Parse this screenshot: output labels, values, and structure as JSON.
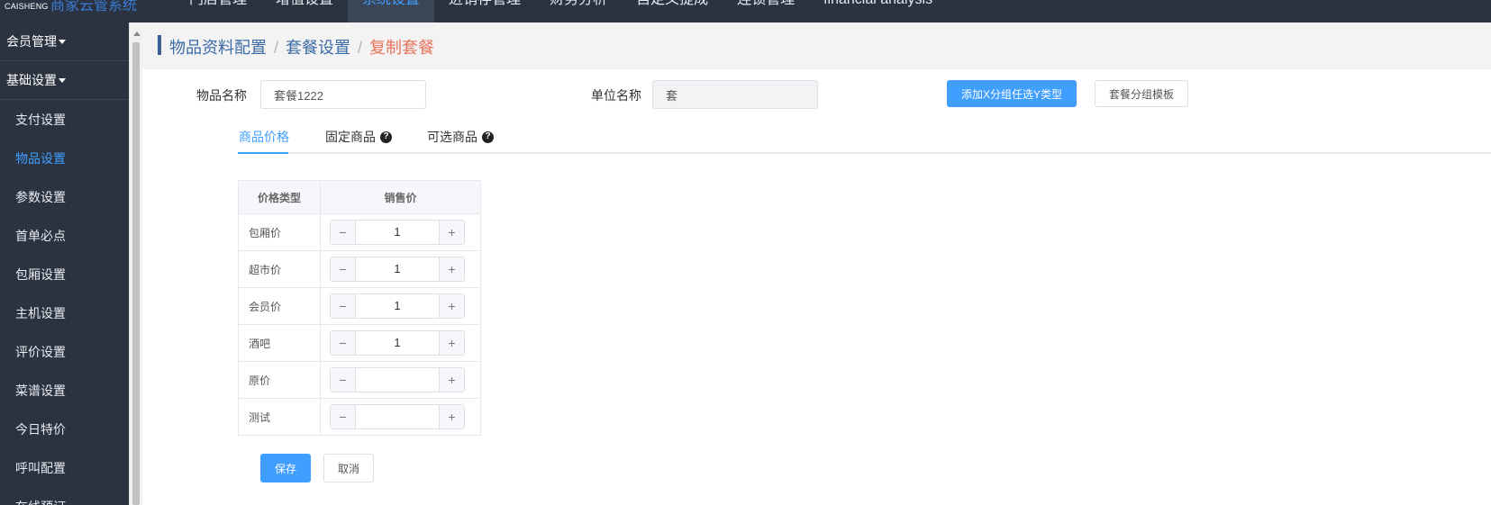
{
  "brand": {
    "en": "CAISHENG",
    "cn": "商家云管系统"
  },
  "nav": [
    {
      "label": "门店管理",
      "active": false
    },
    {
      "label": "增值设置",
      "active": false
    },
    {
      "label": "系统设置",
      "active": true
    },
    {
      "label": "进销存管理",
      "active": false
    },
    {
      "label": "财务分析",
      "active": false
    },
    {
      "label": "自定义提成",
      "active": false
    },
    {
      "label": "连锁管理",
      "active": false
    },
    {
      "label": "financial analysis",
      "active": false
    }
  ],
  "sidebar": {
    "groups": [
      {
        "label": "会员管理"
      },
      {
        "label": "基础设置"
      }
    ],
    "items": [
      {
        "label": "支付设置"
      },
      {
        "label": "物品设置"
      },
      {
        "label": "参数设置"
      },
      {
        "label": "首单必点"
      },
      {
        "label": "包厢设置"
      },
      {
        "label": "主机设置"
      },
      {
        "label": "评价设置"
      },
      {
        "label": "菜谱设置"
      },
      {
        "label": "今日特价"
      },
      {
        "label": "呼叫配置"
      },
      {
        "label": "在线预订"
      }
    ],
    "active_item": "物品设置"
  },
  "breadcrumb": [
    "物品资料配置",
    "套餐设置",
    "复制套餐"
  ],
  "form": {
    "item_name_label": "物品名称",
    "item_name_value": "套餐1222",
    "unit_label": "单位名称",
    "unit_value": "套",
    "add_group_button": "添加X分组任选Y类型",
    "group_template_button": "套餐分组模板"
  },
  "tabs": [
    {
      "label": "商品价格",
      "active": true,
      "help": false
    },
    {
      "label": "固定商品",
      "active": false,
      "help": true
    },
    {
      "label": "可选商品",
      "active": false,
      "help": true
    }
  ],
  "price_table": {
    "headers": [
      "价格类型",
      "销售价"
    ],
    "rows": [
      {
        "type": "包厢价",
        "value": "1"
      },
      {
        "type": "超市价",
        "value": "1"
      },
      {
        "type": "会员价",
        "value": "1"
      },
      {
        "type": "酒吧",
        "value": "1"
      },
      {
        "type": "原价",
        "value": ""
      },
      {
        "type": "测试",
        "value": ""
      }
    ]
  },
  "actions": {
    "save": "保存",
    "cancel": "取消"
  },
  "icons": {
    "minus": "−",
    "plus": "+",
    "help": "?"
  },
  "colors": {
    "primary": "#409eff",
    "sidebar_bg": "#2b3341",
    "crumb_current": "#e8735a",
    "crumb_link": "#3b6aa6"
  }
}
